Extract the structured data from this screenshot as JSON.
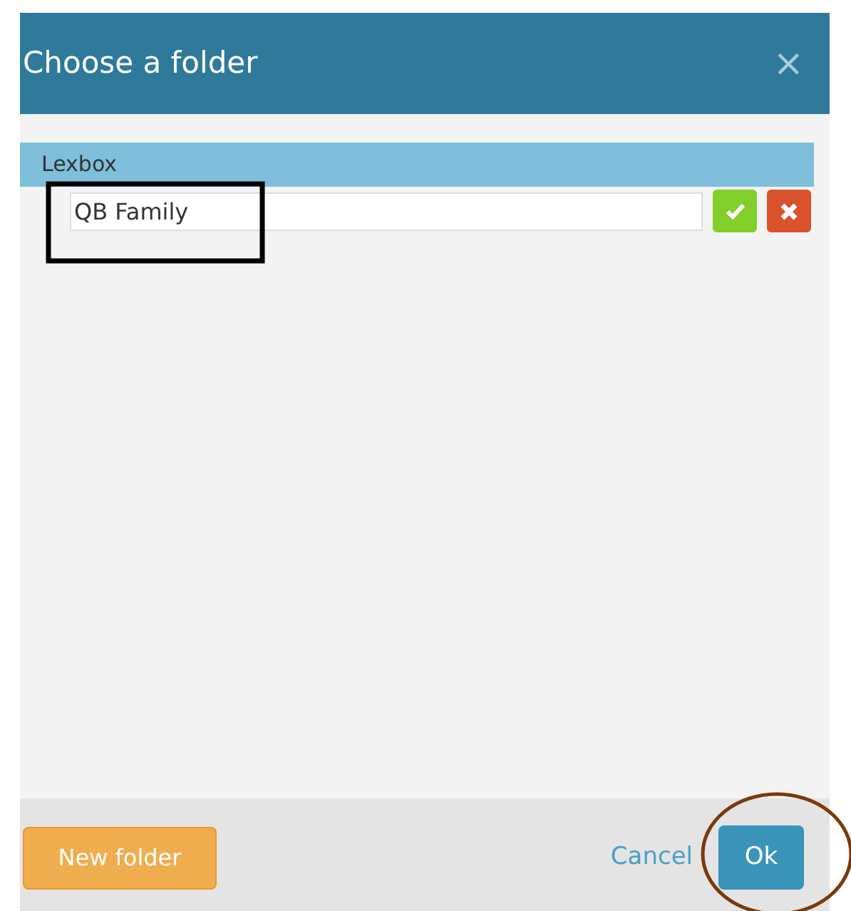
{
  "dialog": {
    "title": "Choose a folder",
    "close": "×"
  },
  "folder": {
    "name": "Lexbox",
    "selected": true
  },
  "new_folder_field": {
    "value": "QB Family"
  },
  "footer": {
    "new_folder": "New folder",
    "cancel": "Cancel",
    "ok": "Ok"
  }
}
